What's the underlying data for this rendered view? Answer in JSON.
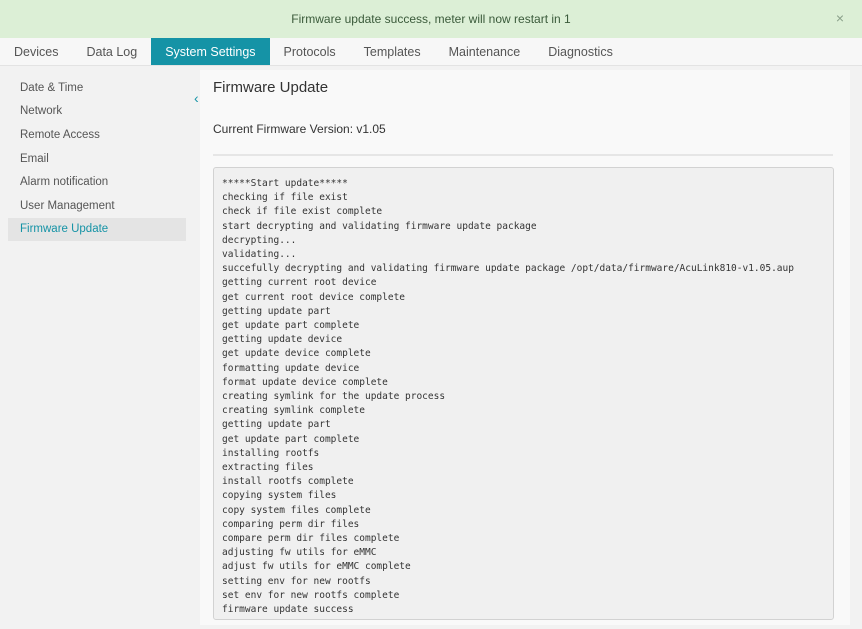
{
  "banner": {
    "message": "Firmware update success, meter will now restart in 1",
    "close_glyph": "×"
  },
  "tabs": [
    {
      "label": "Devices",
      "active": false
    },
    {
      "label": "Data Log",
      "active": false
    },
    {
      "label": "System Settings",
      "active": true
    },
    {
      "label": "Protocols",
      "active": false
    },
    {
      "label": "Templates",
      "active": false
    },
    {
      "label": "Maintenance",
      "active": false
    },
    {
      "label": "Diagnostics",
      "active": false
    }
  ],
  "sidebar": {
    "collapse_glyph": "‹",
    "items": [
      {
        "label": "Date & Time",
        "active": false
      },
      {
        "label": "Network",
        "active": false
      },
      {
        "label": "Remote Access",
        "active": false
      },
      {
        "label": "Email",
        "active": false
      },
      {
        "label": "Alarm notification",
        "active": false
      },
      {
        "label": "User Management",
        "active": false
      },
      {
        "label": "Firmware Update",
        "active": true
      }
    ]
  },
  "main": {
    "title": "Firmware Update",
    "current_version": "Current Firmware Version: v1.05",
    "log": [
      "*****Start update*****",
      "checking if file exist",
      "check if file exist complete",
      "start decrypting and validating firmware update package",
      "decrypting...",
      "validating...",
      "succefully decrypting and validating firmware update package /opt/data/firmware/AcuLink810-v1.05.aup",
      "getting current root device",
      "get current root device complete",
      "getting update part",
      "get update part complete",
      "getting update device",
      "get update device complete",
      "formatting update device",
      "format update device complete",
      "creating symlink for the update process",
      "creating symlink complete",
      "getting update part",
      "get update part complete",
      "installing rootfs",
      "extracting files",
      "install rootfs complete",
      "copying system files",
      "copy system files complete",
      "comparing perm dir files",
      "compare perm dir files complete",
      "adjusting fw utils for eMMC",
      "adjust fw utils for eMMC complete",
      "setting env for new rootfs",
      "set env for new rootfs complete",
      "firmware update success"
    ]
  },
  "colors": {
    "accent": "#1593a6",
    "banner_bg": "#dcefd6"
  }
}
